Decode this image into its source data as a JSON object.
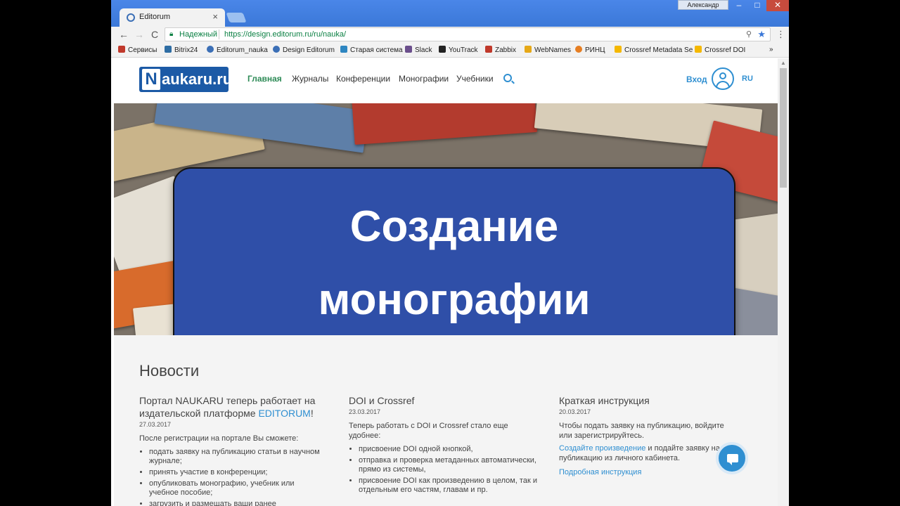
{
  "browser": {
    "tab_title": "Editorum",
    "tab_close": "×",
    "user_name": "Александр",
    "min": "–",
    "max": "□",
    "close": "✕",
    "back": "←",
    "forward": "→",
    "reload": "C",
    "secure_label": "Надежный",
    "url": "https://design.editorum.ru/ru/nauka/",
    "star": "★",
    "key": "⚲",
    "menu": "⋮",
    "bookmarks": [
      {
        "label": "Сервисы",
        "icon": "apps-icon",
        "color": "#c0392b"
      },
      {
        "label": "Bitrix24",
        "icon": "bitrix-icon",
        "color": "#2e6da4"
      },
      {
        "label": "Editorum_nauka",
        "icon": "editorum-icon",
        "color": "#3b6fb6"
      },
      {
        "label": "Design Editorum",
        "icon": "editorum-icon",
        "color": "#3b6fb6"
      },
      {
        "label": "Старая система",
        "icon": "grid-icon",
        "color": "#2e86c1"
      },
      {
        "label": "Slack",
        "icon": "slack-icon",
        "color": "#6b4f8c"
      },
      {
        "label": "YouTrack",
        "icon": "youtrack-icon",
        "color": "#222222"
      },
      {
        "label": "Zabbix",
        "icon": "zabbix-icon",
        "color": "#c0392b"
      },
      {
        "label": "WebNames",
        "icon": "webnames-icon",
        "color": "#e6a817"
      },
      {
        "label": "РИНЦ",
        "icon": "rinc-icon",
        "color": "#e67e22"
      },
      {
        "label": "Crossref Metadata Se",
        "icon": "crossref-icon",
        "color": "#f5b800"
      },
      {
        "label": "Crossref DOI",
        "icon": "crossref-icon",
        "color": "#f5b800"
      }
    ],
    "bookmarks_more": "»"
  },
  "site": {
    "logo_n": "N",
    "logo_rest": "aukaru.ru",
    "nav": [
      "Главная",
      "Журналы",
      "Конференции",
      "Монографии",
      "Учебники"
    ],
    "login": "Вход",
    "lang": "RU"
  },
  "hero": {
    "line1": "Создание",
    "line2": "монографии",
    "overlay_color": "#2f4fa8"
  },
  "news": {
    "title": "Новости",
    "items": [
      {
        "title_part1": "Портал NAUKARU теперь работает на издательской платформе ",
        "title_link": "EDITORUM",
        "title_part2": "!",
        "date": "27.03.2017",
        "intro": "После регистрации на портале Вы сможете:",
        "bullets": [
          "подать заявку на публикацию статьи в научном журнале;",
          "принять участие в конференции;",
          "опубликовать монографию, учебник или учебное пособие;",
          "загрузить и размещать ваши ранее"
        ]
      },
      {
        "title": "DOI и Crossref",
        "date": "23.03.2017",
        "intro": "Теперь работать с DOI и Crossref стало еще удобнее:",
        "bullets": [
          "присвоение DOI одной кнопкой,",
          "отправка и проверка метаданных автоматически, прямо из системы,",
          "присвоение DOI как произведению в целом, так и отдельным его частям, главам и пр."
        ]
      },
      {
        "title": "Краткая инструкция",
        "date": "20.03.2017",
        "intro": "Чтобы подать заявку на публикацию, войдите или зарегистрируйтесь.",
        "link1": "Создайте произведение",
        "text1": " и подайте заявку на публикацию из личного кабинета.",
        "link2": "Подробная инструкция"
      }
    ]
  }
}
